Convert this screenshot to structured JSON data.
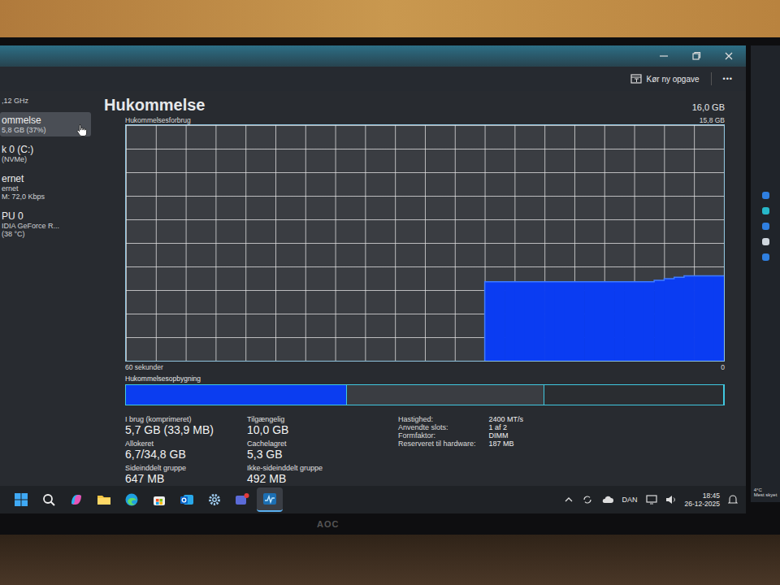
{
  "window": {
    "command": "Kør ny opgave",
    "more": "•••"
  },
  "sidebar": {
    "items": [
      {
        "lines": [
          ",12 GHz"
        ],
        "selected": false
      },
      {
        "lines": [
          "ommelse",
          "5,8 GB (37%)"
        ],
        "selected": true
      },
      {
        "lines": [
          "k 0 (C:)",
          "(NVMe)"
        ],
        "selected": false
      },
      {
        "lines": [
          "ernet",
          "ernet",
          "M: 72,0 Kbps"
        ],
        "selected": false
      },
      {
        "lines": [
          "PU 0",
          "IDIA GeForce R...",
          "(38 °C)"
        ],
        "selected": false
      }
    ]
  },
  "header": {
    "title": "Hukommelse",
    "total": "16,0 GB"
  },
  "chart": {
    "title": "Hukommelsesforbrug",
    "max_label": "15,8 GB",
    "x_start": "60 sekunder",
    "x_end": "0",
    "values": [
      0,
      0,
      0,
      0,
      0,
      0,
      0,
      0,
      0,
      0,
      0,
      0,
      0,
      0,
      0,
      0,
      0,
      0,
      0,
      0,
      0,
      0,
      0,
      0,
      0,
      0,
      0,
      0,
      0,
      0,
      0,
      0,
      0,
      0,
      0,
      0,
      5.3,
      5.3,
      5.3,
      5.3,
      5.3,
      5.3,
      5.3,
      5.3,
      5.3,
      5.3,
      5.3,
      5.3,
      5.3,
      5.3,
      5.3,
      5.3,
      5.3,
      5.4,
      5.5,
      5.6,
      5.7,
      5.7,
      5.7,
      5.7
    ]
  },
  "composition": {
    "title": "Hukommelsesopbygning",
    "segments": [
      {
        "kind": "in-use",
        "level": 0.37
      },
      {
        "kind": "standby",
        "level": 0.33
      },
      {
        "kind": "free",
        "level": 0.3
      }
    ]
  },
  "stats": [
    {
      "label": "I brug (komprimeret)",
      "value": "5,7 GB (33,9 MB)"
    },
    {
      "label": "Tilgængelig",
      "value": "10,0 GB"
    },
    {
      "label": "Allokeret",
      "value": "6,7/34,8 GB"
    },
    {
      "label": "Cachelagret",
      "value": "5,3 GB"
    },
    {
      "label": "Sideinddelt gruppe",
      "value": "647 MB"
    },
    {
      "label": "Ikke-sideinddelt gruppe",
      "value": "492 MB"
    }
  ],
  "specs": [
    {
      "label": "Hastighed:",
      "value": "2400 MT/s"
    },
    {
      "label": "Anvendte slots:",
      "value": "1 af 2"
    },
    {
      "label": "Formfaktor:",
      "value": "DIMM"
    },
    {
      "label": "Reserveret til hardware:",
      "value": "187 MB"
    }
  ],
  "taskbar": {
    "apps": [
      {
        "kind": "start",
        "selected": false
      },
      {
        "kind": "search",
        "selected": false
      },
      {
        "kind": "copilot",
        "selected": false
      },
      {
        "kind": "folder",
        "selected": false
      },
      {
        "kind": "edge",
        "selected": false
      },
      {
        "kind": "store",
        "selected": false
      },
      {
        "kind": "outlook",
        "selected": false
      },
      {
        "kind": "settings",
        "selected": false
      },
      {
        "kind": "teams",
        "selected": false
      },
      {
        "kind": "taskmanager",
        "selected": true
      }
    ],
    "language": "DAN",
    "time": "18:45",
    "date": "26-12-2025"
  },
  "side_monitor": {
    "temperature": "4°C",
    "condition": "Mest skyet"
  },
  "monitor": {
    "brand": "AOC"
  }
}
